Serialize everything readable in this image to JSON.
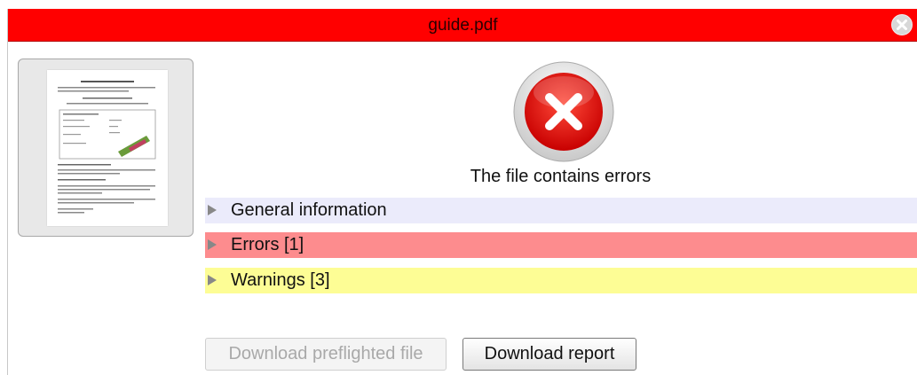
{
  "window": {
    "title": "guide.pdf",
    "title_bar_color": "#ff0000"
  },
  "status": {
    "message": "The file contains errors",
    "icon": "error-x-icon",
    "icon_color": "#e00000"
  },
  "sections": [
    {
      "label": "General information",
      "color": "#ebebfb",
      "expanded": false
    },
    {
      "label": "Errors [1]",
      "color": "#fd8c8e",
      "expanded": false
    },
    {
      "label": "Warnings [3]",
      "color": "#fdfd95",
      "expanded": false
    }
  ],
  "buttons": {
    "download_preflighted": "Download preflighted file",
    "download_preflighted_enabled": false,
    "download_report": "Download report"
  },
  "icons": {
    "close": "close-icon",
    "expand": "triangle-right-icon",
    "thumbnail": "document-thumbnail"
  }
}
